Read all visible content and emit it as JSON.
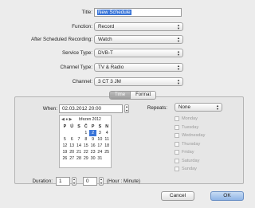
{
  "form": {
    "title_label": "Title:",
    "title_value": "New Schedule",
    "function_label": "Function:",
    "function_value": "Record",
    "after_label": "After Scheduled Recording:",
    "after_value": "Watch",
    "service_label": "Service Type:",
    "service_value": "DVB-T",
    "channel_type_label": "Channel Type:",
    "channel_type_value": "TV & Radio",
    "channel_label": "Channel:",
    "channel_value": "3 CT 3 JM"
  },
  "tabs": [
    "Time",
    "Format"
  ],
  "time_tab": {
    "when_label": "When:",
    "when_value": "02.03.2012 20:00",
    "calendar": {
      "nav": "◀ ● ▶",
      "month": "březen 2012",
      "dow": [
        "P",
        "Ú",
        "S",
        "Č",
        "P",
        "S",
        "N"
      ],
      "weeks": [
        [
          "",
          "",
          "",
          "1",
          "2",
          "3",
          "4"
        ],
        [
          "5",
          "6",
          "7",
          "8",
          "9",
          "10",
          "11"
        ],
        [
          "12",
          "13",
          "14",
          "15",
          "16",
          "17",
          "18"
        ],
        [
          "19",
          "20",
          "21",
          "22",
          "23",
          "24",
          "25"
        ],
        [
          "26",
          "27",
          "28",
          "29",
          "30",
          "31",
          ""
        ]
      ],
      "selected_day": "2"
    },
    "repeats_label": "Repeats:",
    "repeats_value": "None",
    "days": [
      "Monday",
      "Tuesday",
      "Wednesday",
      "Thursday",
      "Friday",
      "Saturday",
      "Sunday"
    ],
    "duration_label": "Duration:",
    "duration_hours": "1",
    "duration_minutes": "0",
    "duration_units": "(Hour : Minute)"
  },
  "buttons": {
    "cancel": "Cancel",
    "ok": "OK"
  }
}
